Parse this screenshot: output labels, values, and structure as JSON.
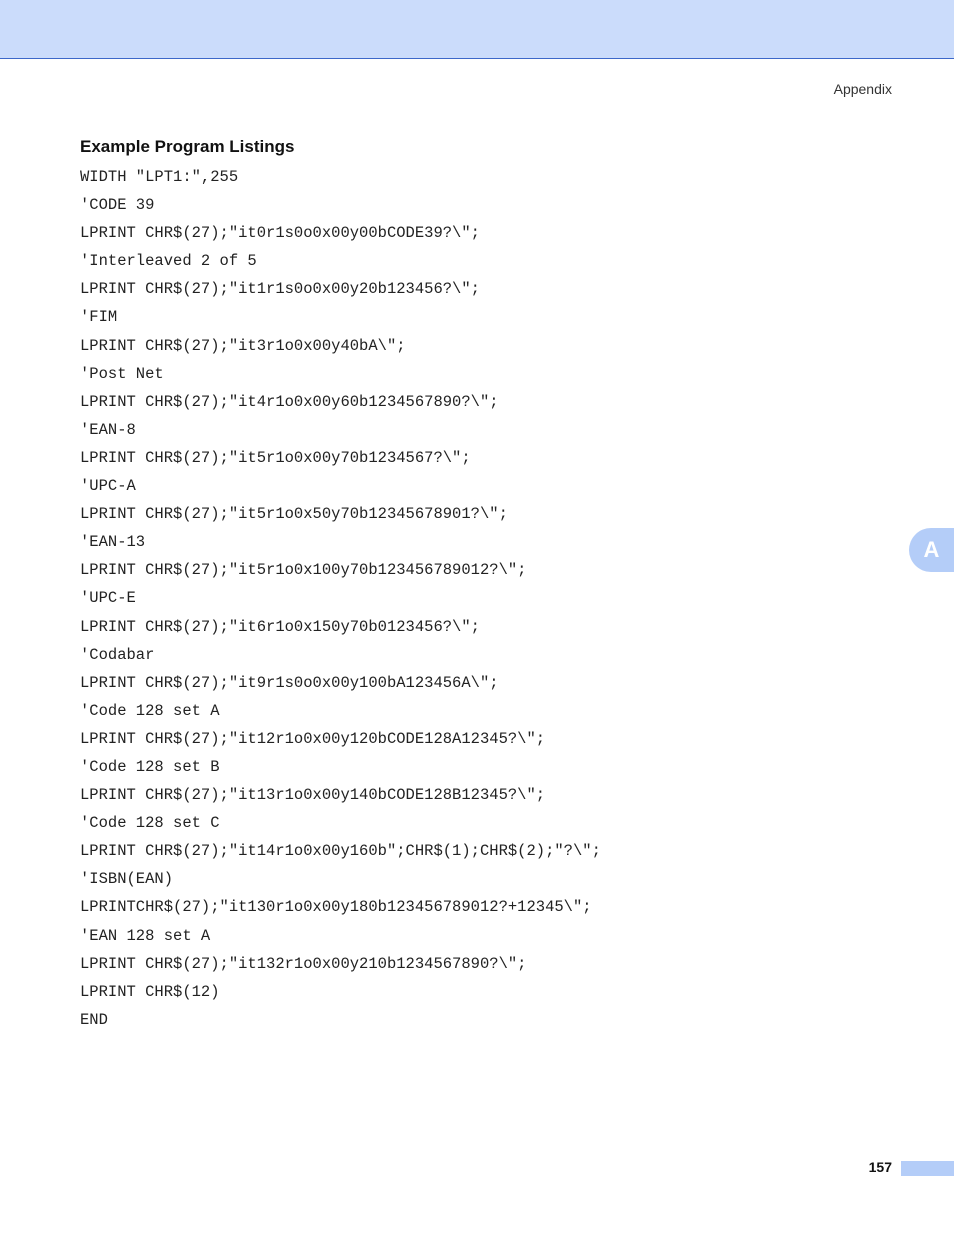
{
  "header": {
    "section_label": "Appendix"
  },
  "main": {
    "heading": "Example Program Listings",
    "code_lines": [
      "WIDTH \"LPT1:\",255",
      "'CODE 39",
      "LPRINT CHR$(27);\"it0r1s0o0x00y00bCODE39?\\\";",
      "'Interleaved 2 of 5",
      "LPRINT CHR$(27);\"it1r1s0o0x00y20b123456?\\\";",
      "'FIM",
      "LPRINT CHR$(27);\"it3r1o0x00y40bA\\\";",
      "'Post Net",
      "LPRINT CHR$(27);\"it4r1o0x00y60b1234567890?\\\";",
      "'EAN-8",
      "LPRINT CHR$(27);\"it5r1o0x00y70b1234567?\\\";",
      "'UPC-A",
      "LPRINT CHR$(27);\"it5r1o0x50y70b12345678901?\\\";",
      "'EAN-13",
      "LPRINT CHR$(27);\"it5r1o0x100y70b123456789012?\\\";",
      "'UPC-E",
      "LPRINT CHR$(27);\"it6r1o0x150y70b0123456?\\\";",
      "'Codabar",
      "LPRINT CHR$(27);\"it9r1s0o0x00y100bA123456A\\\";",
      "'Code 128 set A",
      "LPRINT CHR$(27);\"it12r1o0x00y120bCODE128A12345?\\\";",
      "'Code 128 set B",
      "LPRINT CHR$(27);\"it13r1o0x00y140bCODE128B12345?\\\";",
      "'Code 128 set C",
      "LPRINT CHR$(27);\"it14r1o0x00y160b\";CHR$(1);CHR$(2);\"?\\\";",
      "'ISBN(EAN)",
      "LPRINTCHR$(27);\"it130r1o0x00y180b123456789012?+12345\\\";",
      "'EAN 128 set A",
      "LPRINT CHR$(27);\"it132r1o0x00y210b1234567890?\\\";",
      "LPRINT CHR$(12)",
      "END"
    ]
  },
  "side_tab": {
    "letter": "A"
  },
  "footer": {
    "page_number": "157"
  },
  "colors": {
    "header_band": "#cbdcfb",
    "header_rule": "#3d68c9",
    "tab_blue": "#b4cdf8"
  }
}
